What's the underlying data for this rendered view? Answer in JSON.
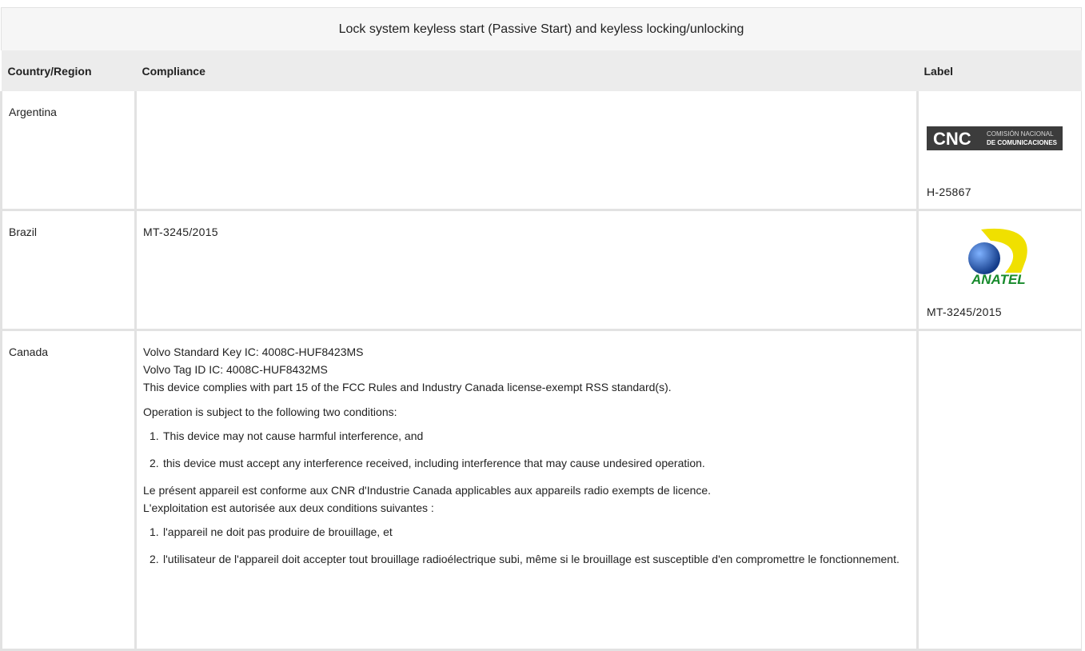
{
  "table": {
    "caption": "Lock system keyless start (Passive Start) and keyless locking/unlocking",
    "headers": {
      "country": "Country/Region",
      "compliance": "Compliance",
      "label": "Label"
    },
    "rows": [
      {
        "country": "Argentina",
        "compliance": "",
        "label_logo": {
          "icon": "cnc-logo",
          "mark": "CNC",
          "line1": "COMISIÓN NACIONAL",
          "line2": "DE COMUNICACIONES"
        },
        "label_code": "H-25867"
      },
      {
        "country": "Brazil",
        "compliance": "MT-3245/2015",
        "label_logo": {
          "icon": "anatel-logo",
          "mark": "ANATEL"
        },
        "label_code": "MT-3245/2015"
      },
      {
        "country": "Canada",
        "compliance_lines": [
          "Volvo Standard Key IC: 4008C-HUF8423MS",
          "Volvo Tag ID IC: 4008C-HUF8432MS",
          "This device complies with part 15 of the FCC Rules and Industry Canada license-exempt RSS standard(s)."
        ],
        "conditions_intro": "Operation is subject to the following two conditions:",
        "conditions": [
          "This device may not cause harmful interference, and",
          "this device must accept any interference received, including interference that may cause undesired operation."
        ],
        "fr_lines": [
          "Le présent appareil est conforme aux CNR d'Industrie Canada applicables aux appareils radio exempts de licence.",
          "L'exploitation est autorisée aux deux conditions suivantes :"
        ],
        "fr_conditions": [
          "l'appareil ne doit pas produire de brouillage, et",
          "l'utilisateur de l'appareil doit accepter tout brouillage radioélectrique subi, même si le brouillage est susceptible d'en compromettre le fonctionnement."
        ],
        "list_numbers": [
          "1.",
          "2."
        ]
      }
    ]
  },
  "colors": {
    "header_bg": "#ececec",
    "caption_bg": "#f6f6f6",
    "border": "#e2e2e2",
    "anatel_yellow": "#f0e000",
    "anatel_blue": "#1d4fa3",
    "anatel_green": "#178a2c"
  }
}
